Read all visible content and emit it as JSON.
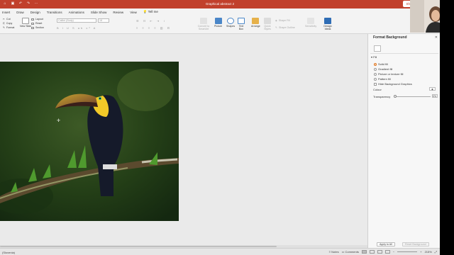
{
  "app": {
    "document_title": "Graphical abstract 2",
    "share_label": "Shar"
  },
  "menu_tabs": [
    "Insert",
    "Draw",
    "Design",
    "Transitions",
    "Animations",
    "Slide Show",
    "Review",
    "View",
    "Tell me"
  ],
  "ribbon": {
    "new_slide": "New Slide",
    "layout": "Layout",
    "reset": "Reset",
    "section": "Section",
    "cut": "Cut",
    "copy": "Copy",
    "format": "Format",
    "font_name": "Calibri (Body)",
    "font_size": "18",
    "convert_to_smartart": "Convert to SmartArt",
    "picture": "Picture",
    "shapes": "Shapes",
    "text_box": "Text Box",
    "arrange": "Arrange",
    "quick_styles": "Quick Styles",
    "shape_fill": "Shape Fill",
    "shape_outline": "Shape Outline",
    "sensitivity": "Sensitivity",
    "design_ideas": "Design Ideas"
  },
  "format_pane": {
    "title": "Format Background",
    "fill_header": "Fill",
    "options": [
      {
        "label": "Solid fill",
        "selected": true
      },
      {
        "label": "Gradient fill",
        "selected": false
      },
      {
        "label": "Picture or texture fill",
        "selected": false
      },
      {
        "label": "Pattern fill",
        "selected": false
      }
    ],
    "hide_graphics": "Hide Background Graphics",
    "colour_label": "Colour",
    "transparency_label": "Transparency",
    "transparency_value": "0%",
    "apply_all": "Apply to All",
    "reset_background": "Reset Background"
  },
  "status": {
    "language": "(Slovenia)",
    "notes": "Notes",
    "comments": "Comments",
    "zoom": "215%"
  },
  "colors": {
    "accent": "#c1402c",
    "radio_selected": "#e07b28"
  }
}
